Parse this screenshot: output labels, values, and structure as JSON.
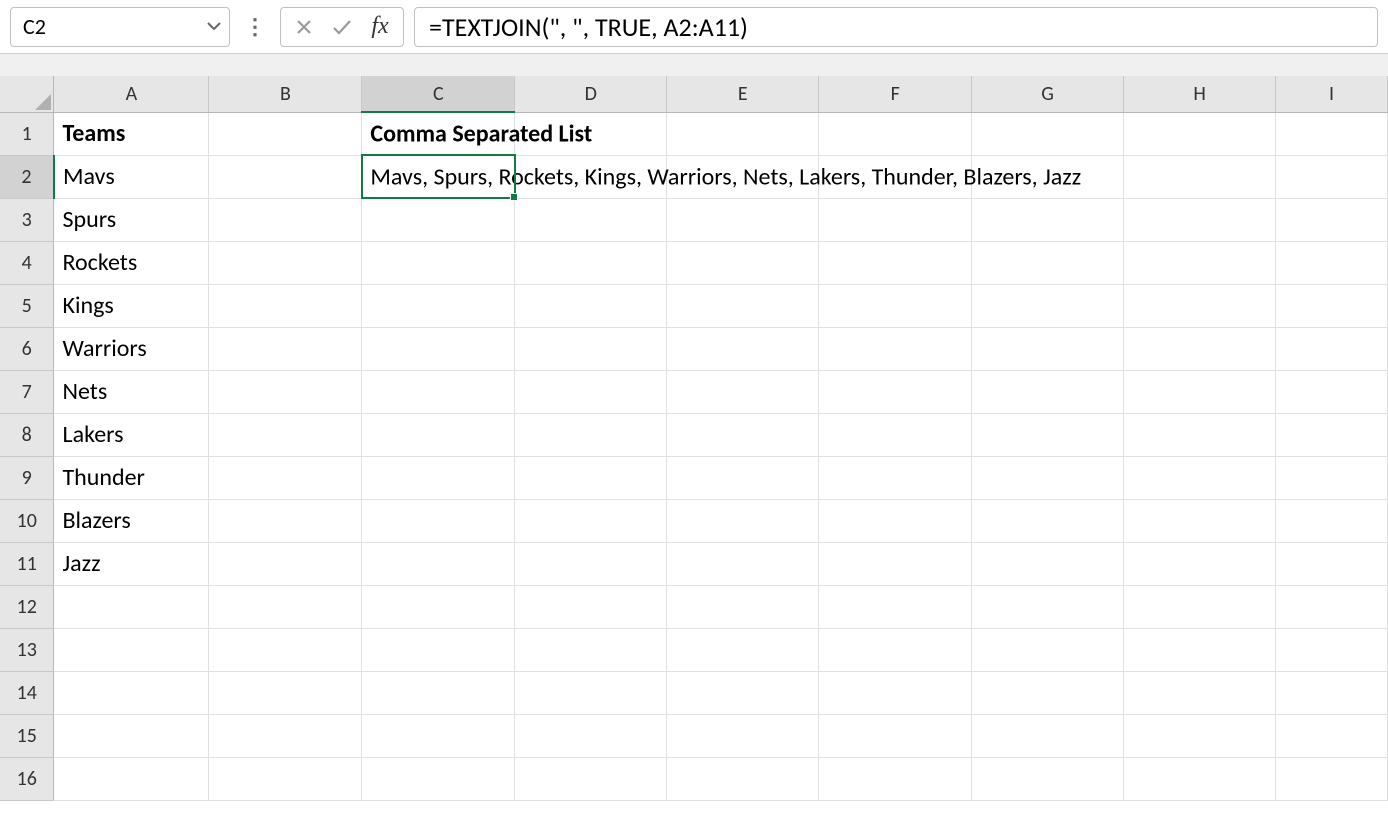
{
  "nameBox": {
    "value": "C2"
  },
  "formulaBar": {
    "formula": "=TEXTJOIN(\", \", TRUE, A2:A11)"
  },
  "columns": [
    "A",
    "B",
    "C",
    "D",
    "E",
    "F",
    "G",
    "H",
    "I"
  ],
  "rows": [
    "1",
    "2",
    "3",
    "4",
    "5",
    "6",
    "7",
    "8",
    "9",
    "10",
    "11",
    "12",
    "13",
    "14",
    "15",
    "16"
  ],
  "activeCell": {
    "col": "C",
    "row": "2"
  },
  "cells": {
    "A1": {
      "value": "Teams",
      "bold": true
    },
    "C1": {
      "value": "Comma Separated List",
      "bold": true,
      "overflow": true
    },
    "A2": {
      "value": "Mavs"
    },
    "C2": {
      "value": "Mavs, Spurs, Rockets, Kings, Warriors, Nets, Lakers, Thunder, Blazers, Jazz",
      "overflow": true
    },
    "A3": {
      "value": "Spurs"
    },
    "A4": {
      "value": "Rockets"
    },
    "A5": {
      "value": "Kings"
    },
    "A6": {
      "value": "Warriors"
    },
    "A7": {
      "value": "Nets"
    },
    "A8": {
      "value": "Lakers"
    },
    "A9": {
      "value": "Thunder"
    },
    "A10": {
      "value": "Blazers"
    },
    "A11": {
      "value": "Jazz"
    }
  }
}
